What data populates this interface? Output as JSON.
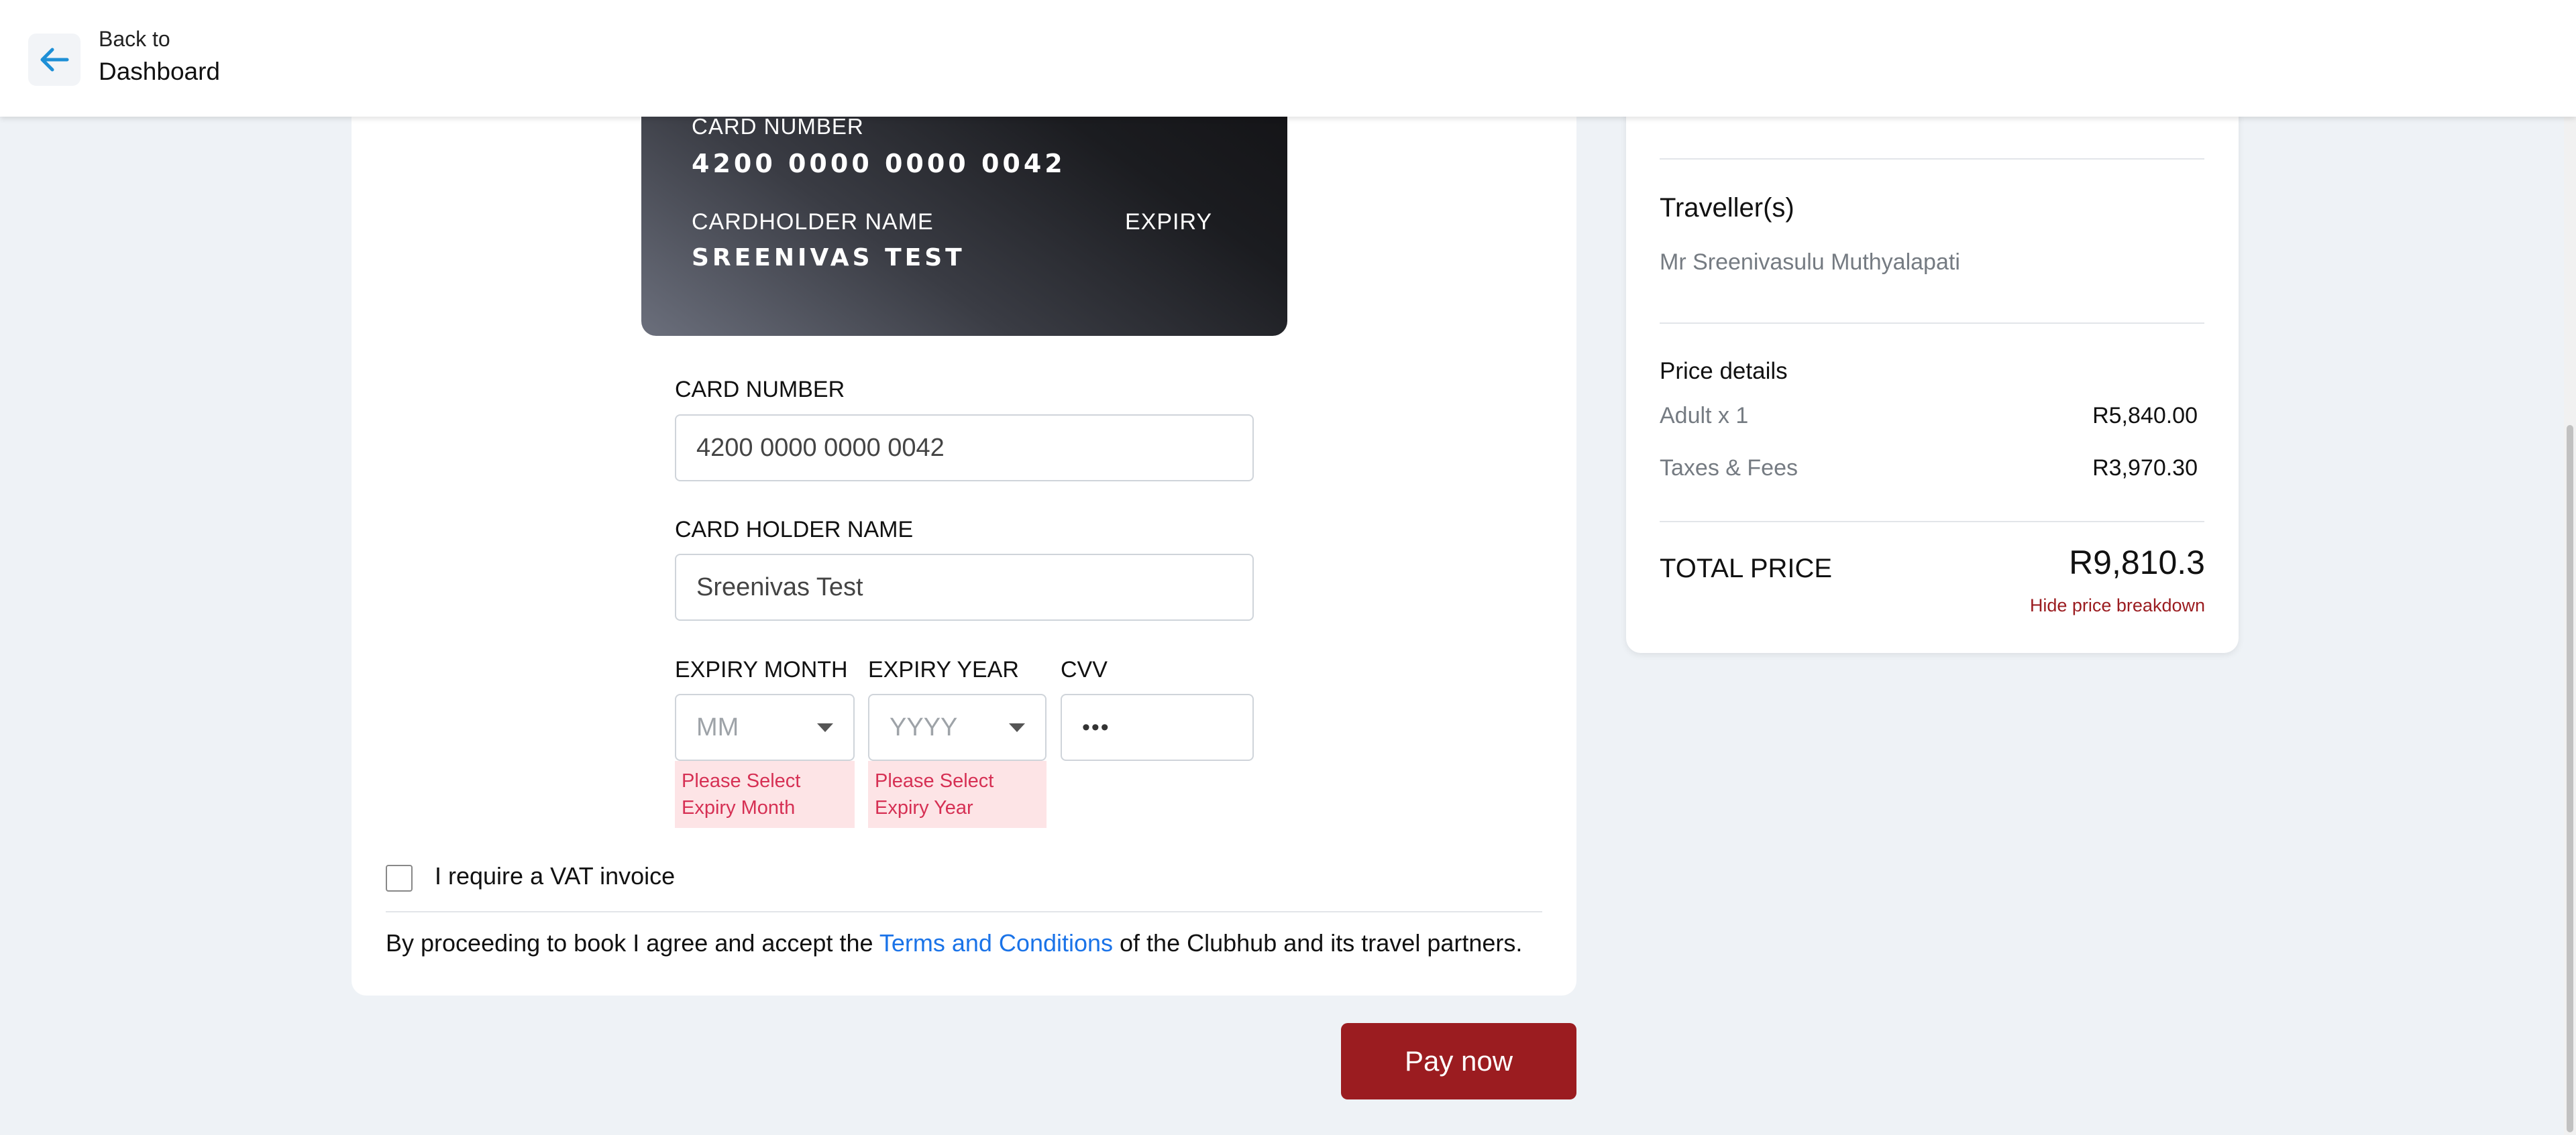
{
  "header": {
    "back_line1": "Back to",
    "back_line2": "Dashboard",
    "back_icon": "arrow-left-icon"
  },
  "card_preview": {
    "label_number": "CARD NUMBER",
    "number": "4200 0000 0000 0042",
    "label_holder": "CARDHOLDER NAME",
    "label_expiry": "EXPIRY",
    "holder": "SREENIVAS TEST"
  },
  "form": {
    "card_number_label": "CARD NUMBER",
    "card_number_value": "4200 0000 0000 0042",
    "holder_label": "CARD HOLDER NAME",
    "holder_value": "Sreenivas Test",
    "expiry_month_label": "EXPIRY MONTH",
    "expiry_month_placeholder": "MM",
    "expiry_month_error": "Please Select Expiry Month",
    "expiry_year_label": "EXPIRY YEAR",
    "expiry_year_placeholder": "YYYY",
    "expiry_year_error": "Please Select Expiry Year",
    "cvv_label": "CVV",
    "cvv_value": "•••"
  },
  "vat": {
    "label": "I require a VAT invoice",
    "checked": false
  },
  "terms": {
    "prefix": "By proceeding to book I agree and accept the ",
    "link": "Terms and Conditions",
    "suffix": " of the Clubhub and its travel partners."
  },
  "pay_button": "Pay now",
  "summary": {
    "travellers_heading": "Traveller(s)",
    "traveller_name": "Mr Sreenivasulu Muthyalapati",
    "price_heading": "Price details",
    "lines": [
      {
        "label": "Adult x 1",
        "value": "R5,840.00"
      },
      {
        "label": "Taxes & Fees",
        "value": "R3,970.30"
      }
    ],
    "total_label": "TOTAL PRICE",
    "total_value": "R9,810.3",
    "hide_link": "Hide price breakdown"
  },
  "colors": {
    "accent": "#9b1c20",
    "link": "#1a73e8",
    "error_text": "#d63054",
    "error_bg": "#fde4e6",
    "back_arrow": "#1e8fd6"
  }
}
